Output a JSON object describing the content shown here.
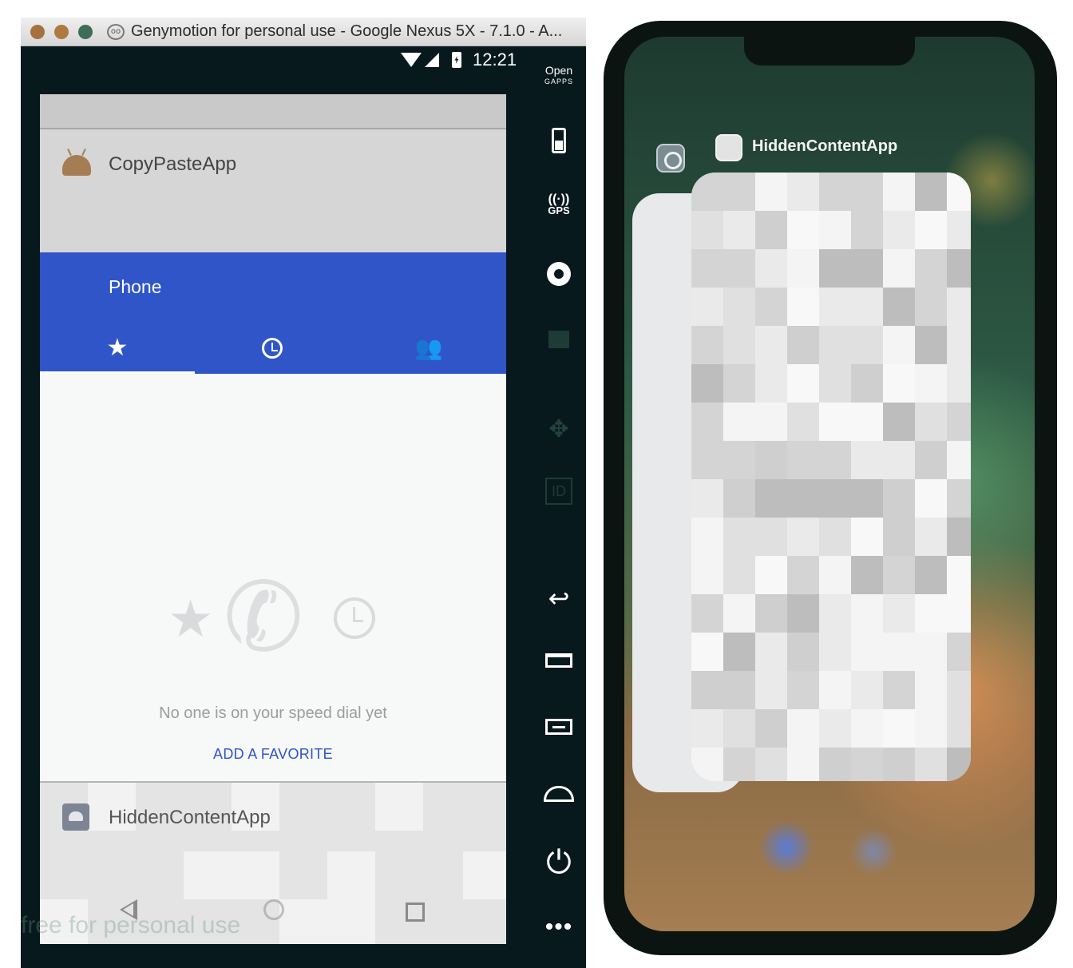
{
  "window": {
    "title": "Genymotion for personal use - Google Nexus 5X - 7.1.0 - A...",
    "logo_glyph": "oo"
  },
  "statusbar": {
    "time": "12:21"
  },
  "toolbar": {
    "opengapps_line1": "Open",
    "opengapps_line2": "GAPPS",
    "gps_label": "GPS",
    "id_label": "ID",
    "back_glyph": "↩",
    "power_glyph": "⏻",
    "more_glyph": "•••",
    "move_glyph": "✥"
  },
  "android": {
    "recents": {
      "copypaste_title": "CopyPasteApp",
      "phone_title": "Phone",
      "hidden_title": "HiddenContentApp"
    },
    "phone": {
      "tabs": {
        "favorites_glyph": "★",
        "contacts_glyph": "👥"
      },
      "empty_message": "No one is on your speed dial yet",
      "add_favorite_label": "ADD A FAVORITE",
      "empty_star_glyph": "★",
      "empty_phone_glyph": "✆"
    },
    "watermark": "free for personal use"
  },
  "ios": {
    "switcher": {
      "hidden_app_label": "HiddenContentApp"
    }
  },
  "colors": {
    "phone_appbar": "#2f55c8",
    "emulator_frame": "#08191d",
    "accent_link": "#2f55c8"
  }
}
